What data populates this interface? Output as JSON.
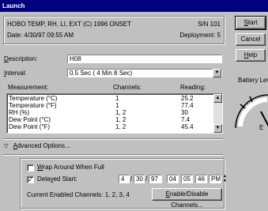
{
  "window": {
    "title": "Launch"
  },
  "info": {
    "device": "HOBO TEMP, RH, LI, EXT (C) 1996 ONSET",
    "serial": "S/N 101",
    "date": "Date: 4/30/97 09:55 AM",
    "deployment": "Deployment: 5"
  },
  "form": {
    "description_label": "Description:",
    "description_value": "H08",
    "interval_label": "Interval:",
    "interval_value": "0.5 Sec ( 4 Min 8 Sec)"
  },
  "table": {
    "headers": [
      "Measurement:",
      "Channels:",
      "Reading:"
    ],
    "rows": [
      [
        "Temperature (°C)",
        "1",
        "25.2"
      ],
      [
        "Temperature (°F)",
        "1",
        "77.4"
      ],
      [
        "RH (%)",
        "1, 2",
        "30"
      ],
      [
        "Dew Point (°C)",
        "1, 2",
        "7.4"
      ],
      [
        "Dew Point (°F)",
        "1, 2",
        "45.4"
      ]
    ]
  },
  "advanced": {
    "label": "Advanced Options..."
  },
  "options": {
    "wrap_label": "Wrap Around When Full",
    "delayed_label": "Delayed Start:",
    "month": "4",
    "day": "30",
    "year": "97",
    "hour": "04",
    "minute": "05",
    "second": "46",
    "ampm": "PM",
    "channels_text": "Current Enabled Channels:  1, 2, 3, 4",
    "enable_button": "Enable/Disable Channels..."
  },
  "buttons": {
    "start": "Start",
    "cancel": "Cancel",
    "help": "Help"
  },
  "battery": {
    "label": "Battery Lev",
    "e_label": "E"
  }
}
